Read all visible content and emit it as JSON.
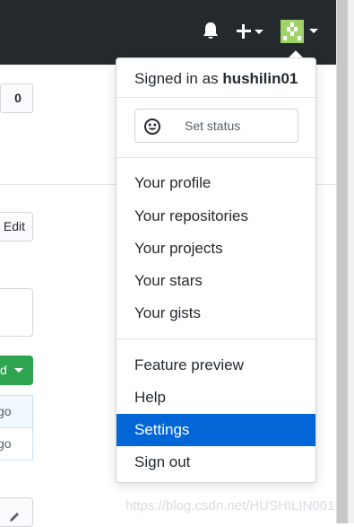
{
  "left_partial": {
    "count_value": "0",
    "edit_label": "Edit",
    "green_button_label": "d",
    "rows": [
      "go",
      "go"
    ]
  },
  "dropdown": {
    "signed_in_prefix": "Signed in as",
    "username": "hushilin01",
    "set_status_label": "Set status",
    "group1": [
      "Your profile",
      "Your repositories",
      "Your projects",
      "Your stars",
      "Your gists"
    ],
    "group2": [
      "Feature preview",
      "Help",
      "Settings",
      "Sign out"
    ],
    "active_item": "Settings"
  },
  "watermark": "https://blog.csdn.net/HUSHILIN001",
  "colors": {
    "header_bg": "#24292e",
    "active_bg": "#0366d6",
    "green_button": "#2ea44f"
  },
  "icons": [
    "bell-icon",
    "plus-icon",
    "caret-down-icon",
    "avatar",
    "smiley-icon",
    "pencil-icon"
  ]
}
